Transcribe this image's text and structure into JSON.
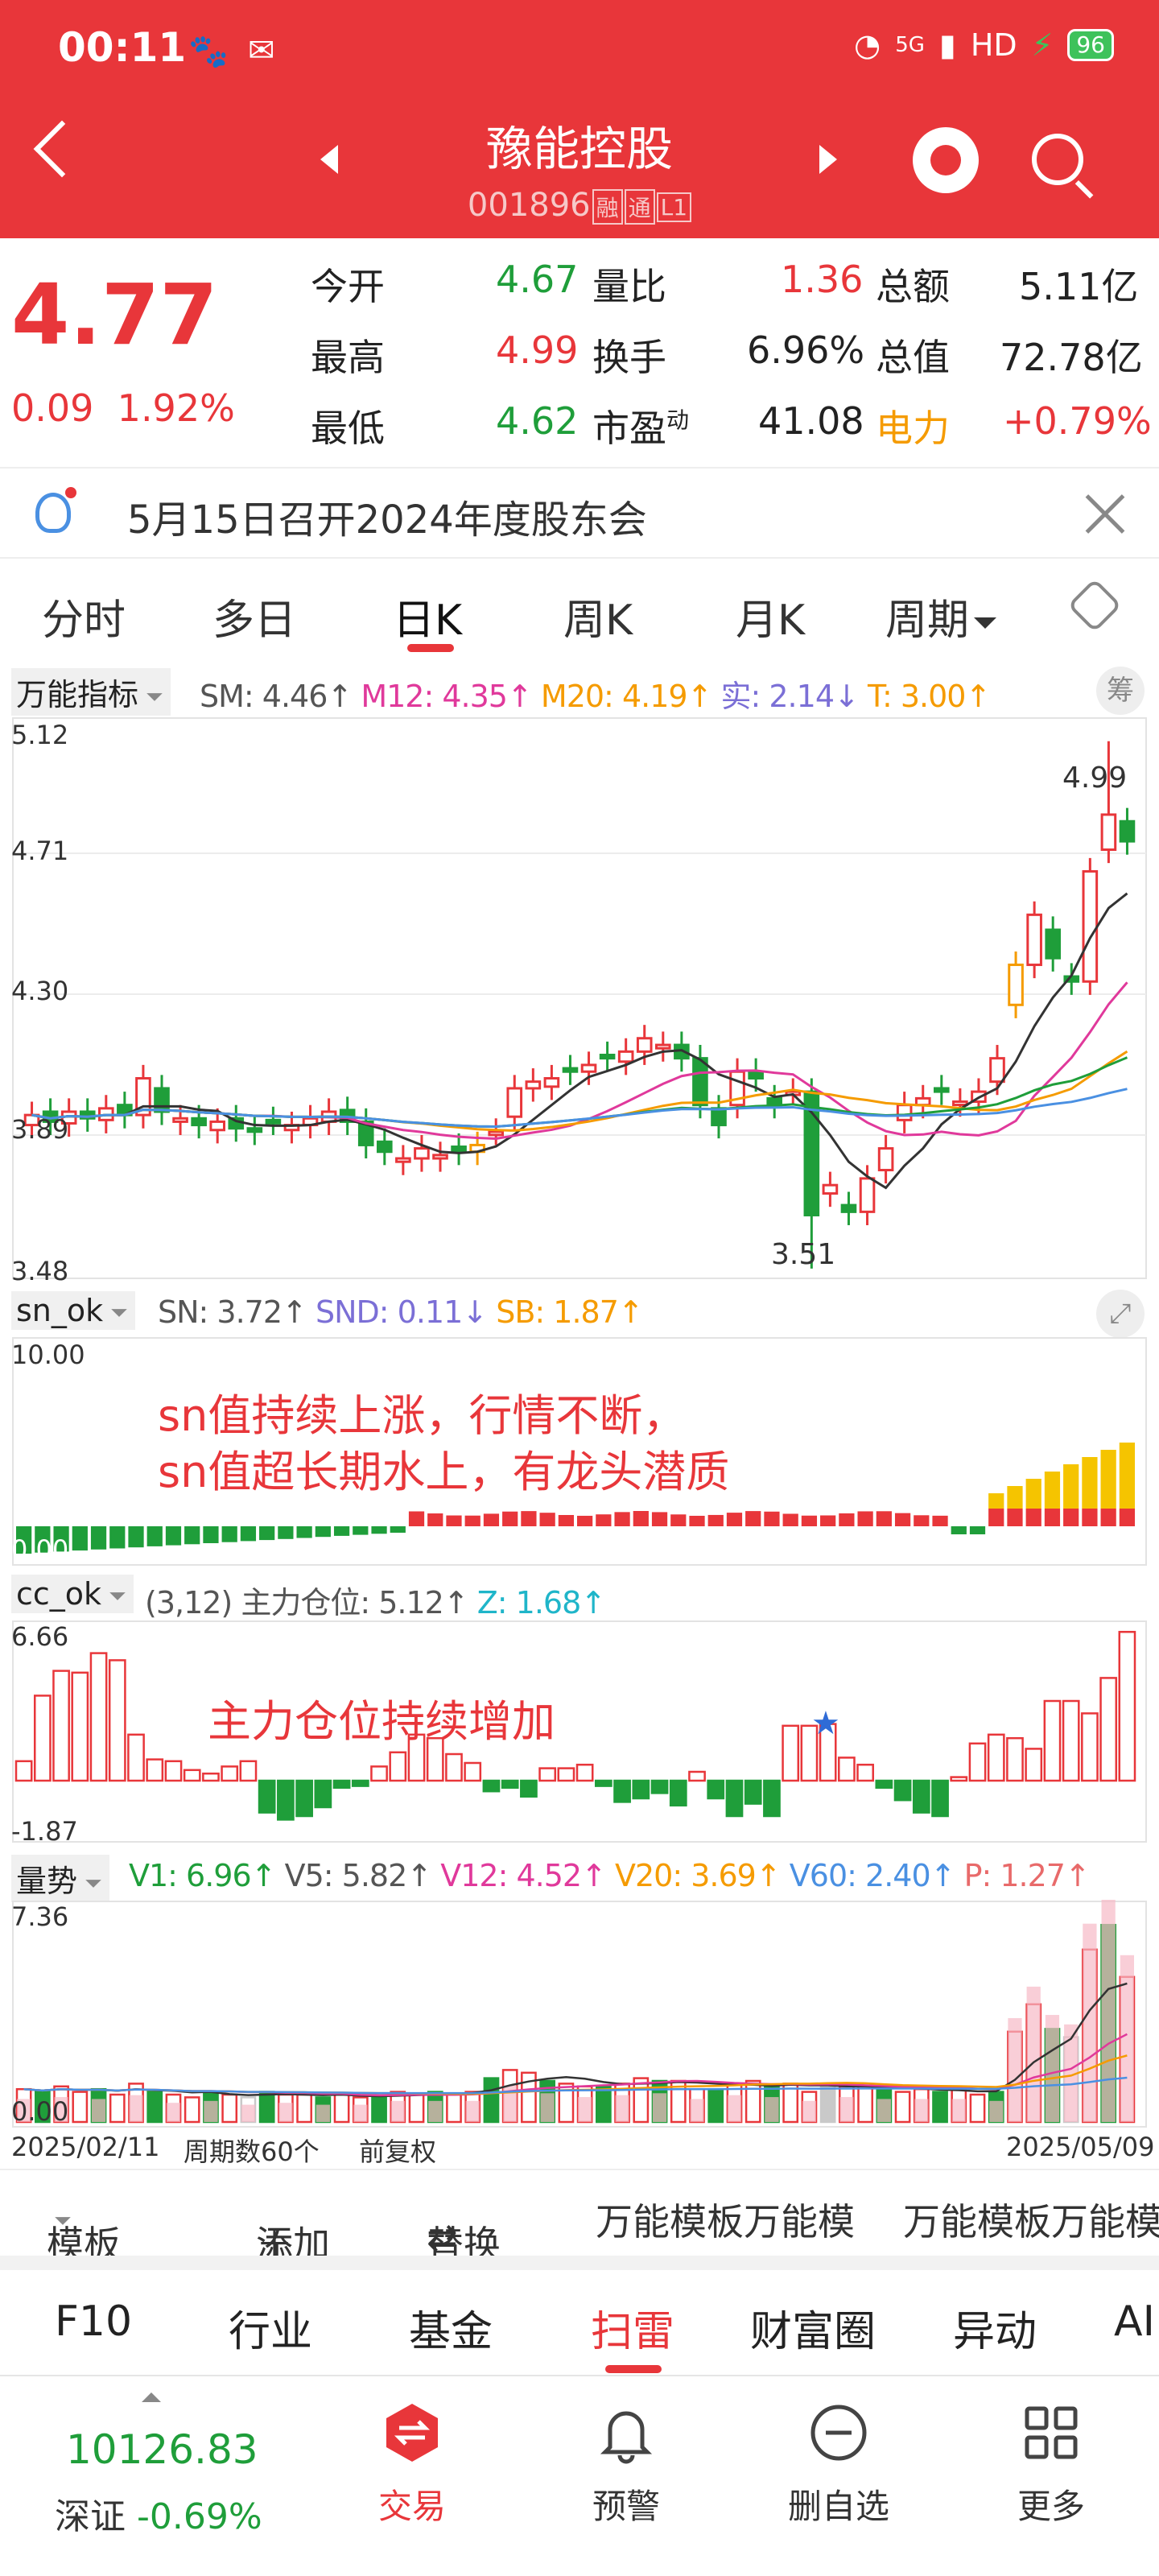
{
  "status_bar": {
    "time": "00:11",
    "network": "5G",
    "hd": "HD",
    "battery": "96"
  },
  "header": {
    "title": "豫能控股",
    "code": "001896",
    "tags": [
      "融",
      "通",
      "L1"
    ]
  },
  "quote": {
    "price": "4.77",
    "change": "0.09",
    "change_pct": "1.92%",
    "rows": [
      [
        {
          "label": "今开",
          "value": "4.67",
          "color": "grn"
        },
        {
          "label": "量比",
          "value": "1.36",
          "color": "red"
        },
        {
          "label": "总额",
          "value": "5.11亿",
          "color": ""
        }
      ],
      [
        {
          "label": "最高",
          "value": "4.99",
          "color": "red"
        },
        {
          "label": "换手",
          "value": "6.96%",
          "color": ""
        },
        {
          "label": "总值",
          "value": "72.78亿",
          "color": ""
        }
      ],
      [
        {
          "label": "最低",
          "value": "4.62",
          "color": "grn"
        },
        {
          "label": "市盈",
          "value": "41.08",
          "color": ""
        },
        {
          "label": "电力",
          "value": "+0.79%",
          "color": "red"
        }
      ]
    ],
    "pe_sup": "动"
  },
  "notice": {
    "text": "5月15日召开2024年度股东会"
  },
  "tabs": [
    "分时",
    "多日",
    "日K",
    "周K",
    "月K",
    "周期"
  ],
  "kline": {
    "indicator_name": "万能指标",
    "legend": [
      {
        "text": "SM: 4.46↑",
        "color": "#555"
      },
      {
        "text": "M12: 4.35↑",
        "color": "#e0399b"
      },
      {
        "text": "M20: 4.19↑",
        "color": "#f59b00"
      },
      {
        "text": "实: 2.14↓",
        "color": "#7b6fd6"
      },
      {
        "text": "T: 3.00↑",
        "color": "#f59b00"
      }
    ],
    "badge": "筹",
    "y_labels": [
      "5.12",
      "4.71",
      "4.30",
      "3.89",
      "3.48"
    ],
    "hi_label": "4.99",
    "lo_label": "3.51"
  },
  "sn": {
    "name": "sn_ok",
    "legend": [
      {
        "text": "SN: 3.72↑",
        "color": "#555"
      },
      {
        "text": "SND: 0.11↓",
        "color": "#7b6fd6"
      },
      {
        "text": "SB: 1.87↑",
        "color": "#f59b00"
      }
    ],
    "y_top": "10.00",
    "y_bottom": "0.00",
    "annotation_line1": "sn值持续上涨，行情不断，",
    "annotation_line2": "sn值超长期水上，有龙头潜质"
  },
  "cc": {
    "name": "cc_ok",
    "legend": [
      {
        "text": "(3,12) 主力仓位: 5.12↑",
        "color": "#555"
      },
      {
        "text": "Z: 1.68↑",
        "color": "#1fb5c9"
      }
    ],
    "y_top": "6.66",
    "y_bottom": "-1.87",
    "annotation": "主力仓位持续增加",
    "star": "★"
  },
  "vol": {
    "name": "量势",
    "legend": [
      {
        "text": "V1: 6.96↑",
        "color": "#1f9e3a"
      },
      {
        "text": "V5: 5.82↑",
        "color": "#555"
      },
      {
        "text": "V12: 4.52↑",
        "color": "#e0399b"
      },
      {
        "text": "V20: 3.69↑",
        "color": "#f59b00"
      },
      {
        "text": "V60: 2.40↑",
        "color": "#4a90e2"
      },
      {
        "text": "P: 1.27↑",
        "color": "#e86a6a"
      }
    ],
    "y_top": "7.36",
    "y_bottom": "0.00"
  },
  "axis": {
    "start": "2025/02/11",
    "period": "周期数60个",
    "adjust": "前复权",
    "end": "2025/05/09"
  },
  "toolbar": {
    "template": "模板",
    "add": "添加",
    "replace": "替换",
    "item1": "万能模板万能模",
    "item2": "万能模板万能模"
  },
  "bottom_tabs": [
    "F10",
    "行业",
    "基金",
    "扫雷",
    "财富圈",
    "异动",
    "AI"
  ],
  "nav": {
    "index_value": "10126.83",
    "index_name": "深证",
    "index_change": "-0.69%",
    "items": [
      "交易",
      "预警",
      "删自选",
      "更多"
    ]
  }
}
